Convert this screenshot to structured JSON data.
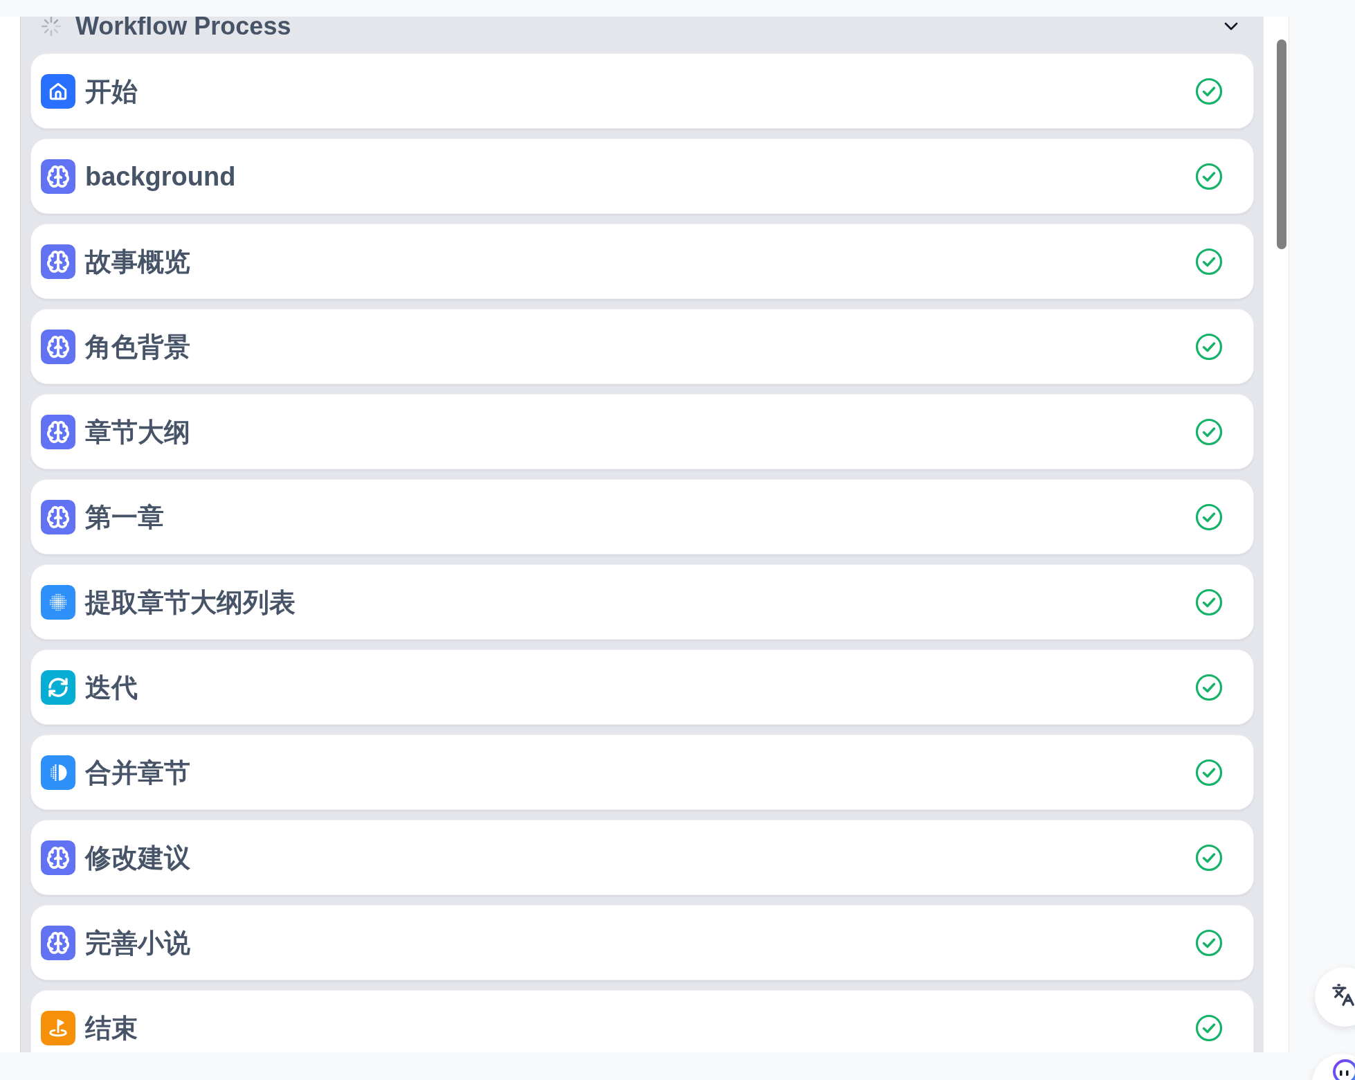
{
  "workflow": {
    "title": "Workflow Process",
    "running": true,
    "expanded": true,
    "nodes": [
      {
        "title": "开始",
        "kind": "start",
        "succeeded": true
      },
      {
        "title": "background",
        "kind": "llm",
        "succeeded": true
      },
      {
        "title": "故事概览",
        "kind": "llm",
        "succeeded": true
      },
      {
        "title": "角色背景",
        "kind": "llm",
        "succeeded": true
      },
      {
        "title": "章节大纲",
        "kind": "llm",
        "succeeded": true
      },
      {
        "title": "第一章",
        "kind": "llm",
        "succeeded": true
      },
      {
        "title": "提取章节大纲列表",
        "kind": "extractor",
        "succeeded": true
      },
      {
        "title": "迭代",
        "kind": "iteration",
        "succeeded": true
      },
      {
        "title": "合并章节",
        "kind": "aggregator",
        "succeeded": true
      },
      {
        "title": "修改建议",
        "kind": "llm",
        "succeeded": true
      },
      {
        "title": "完善小说",
        "kind": "llm",
        "succeeded": true
      },
      {
        "title": "结束",
        "kind": "end",
        "succeeded": true
      }
    ]
  }
}
